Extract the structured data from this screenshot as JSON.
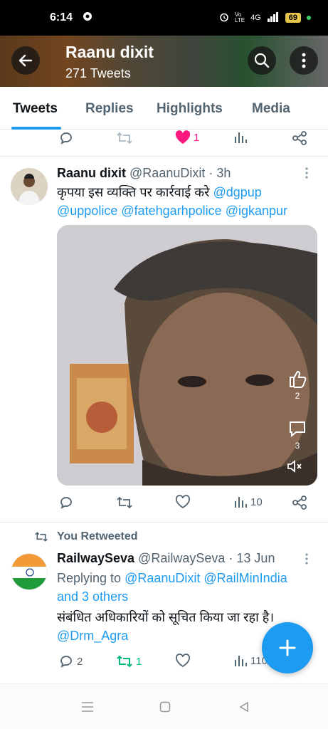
{
  "status_bar": {
    "time": "6:14",
    "network": "4G",
    "battery": "69"
  },
  "header": {
    "title": "Raanu dixit",
    "subtitle": "271 Tweets"
  },
  "tabs": [
    {
      "label": "Tweets",
      "active": true
    },
    {
      "label": "Replies",
      "active": false
    },
    {
      "label": "Highlights",
      "active": false
    },
    {
      "label": "Media",
      "active": false
    }
  ],
  "top_actions": {
    "like_count": "1"
  },
  "tweet1": {
    "name": "Raanu dixit",
    "handle_time": "@RaanuDixit · 3h",
    "text": "कृपया इस व्यक्ति पर कार्रवाई करे",
    "mentions_line1": "@dgpup",
    "mentions_line2": "@uppolice @fatehgarhpolice @igkanpur",
    "media_overlay": {
      "like_count": "2",
      "comment_count": "3"
    },
    "views": "10"
  },
  "tweet2": {
    "retweet_label": "You Retweeted",
    "name": "RailwaySeva",
    "handle_time": "@RailwaySeva · 13 Jun",
    "replying_prefix": "Replying to",
    "replying_users": "@RaanuDixit @RailMinIndia",
    "replying_more": "and 3 others",
    "text": "संबंधित अधिकारियों को सूचित किया जा रहा है।",
    "mention": "@Drm_Agra",
    "reply_count": "2",
    "retweet_count": "1",
    "views": "110"
  },
  "colors": {
    "accent": "#1d9bf0",
    "retweet_green": "#00ba7c",
    "like_pink": "#f91880"
  }
}
